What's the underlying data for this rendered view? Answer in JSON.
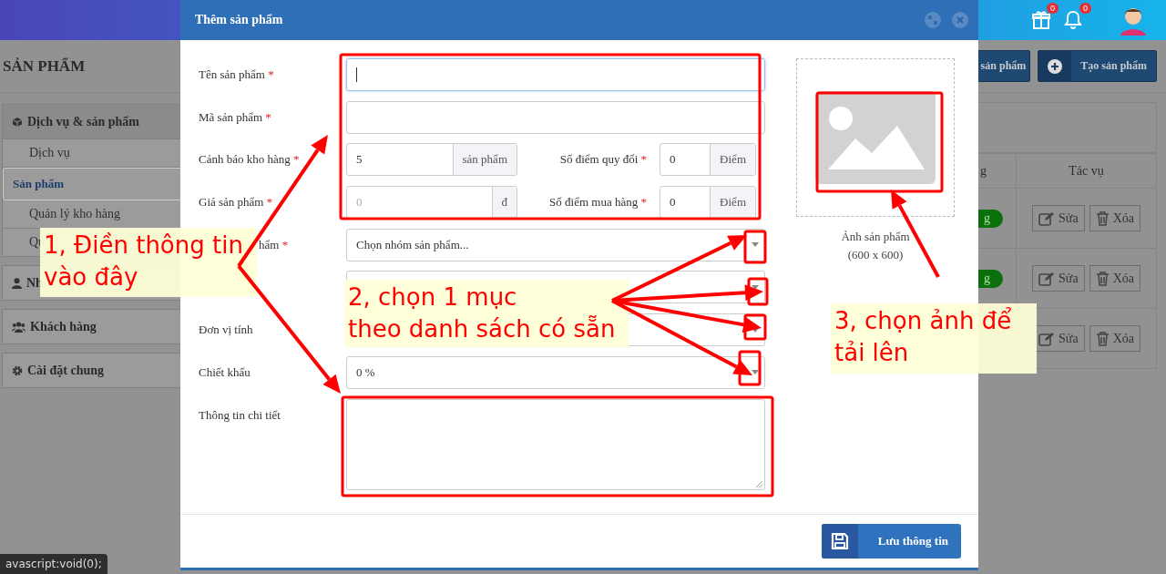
{
  "header": {
    "badges": [
      {
        "count": "0"
      },
      {
        "count": "0"
      }
    ]
  },
  "page_title": "SẢN PHẨM",
  "toolbar_buttons": [
    {
      "kind": "list",
      "label": "sản phẩm"
    },
    {
      "kind": "create",
      "label": "Tạo sản phẩm"
    }
  ],
  "sidebar": {
    "groups": [
      {
        "kind": "box",
        "label": "Dịch vụ & sản phẩm",
        "children": [
          {
            "label": "Dịch vụ",
            "selected": false
          },
          {
            "label": "Sản phẩm",
            "selected": true
          },
          {
            "label": "Quản lý kho hàng",
            "selected": false
          },
          {
            "label": "Qu",
            "selected": false
          }
        ]
      },
      {
        "kind": "user",
        "label": "Nh"
      },
      {
        "kind": "users",
        "label": "Khách hàng"
      },
      {
        "kind": "gear",
        "label": "Cài đặt chung"
      }
    ]
  },
  "table": {
    "columns": [
      "g",
      "Tác vụ"
    ],
    "rows": [
      {
        "status": "g",
        "color": "#0b700b",
        "actions": [
          "Sửa",
          "Xóa"
        ]
      },
      {
        "status": "g",
        "color": "#0b700b",
        "actions": [
          "Sửa",
          "Xóa"
        ]
      },
      {
        "actions": [
          "Sửa",
          "Xóa"
        ]
      }
    ]
  },
  "dialog": {
    "title": "Thêm sản phẩm",
    "fields": [
      {
        "kind": "text",
        "label": "Tên sản phẩm",
        "required_mark": "*",
        "focused": true
      },
      {
        "kind": "text",
        "label": "Mã sản phẩm",
        "required_mark": "*",
        "focused": false
      },
      {
        "kind": "pair",
        "label": "Cảnh báo kho hàng",
        "required_mark": "*",
        "value": "5",
        "addon": "sản phẩm",
        "second": {
          "label": "Số điểm quy đổi",
          "required_mark": "*",
          "value": "0",
          "addon": "Điểm"
        }
      },
      {
        "kind": "pair",
        "label": "Giá sản phẩm",
        "required_mark": "*",
        "placeholder": "0",
        "addon": "đ",
        "second": {
          "label": "Số điểm mua hàng",
          "required_mark": "*",
          "value": "0",
          "addon": "Điểm"
        }
      },
      {
        "kind": "select",
        "label": "hẩm",
        "required_mark": "*",
        "value": "Chọn nhóm sản phẩm..."
      },
      {
        "kind": "select"
      },
      {
        "kind": "select",
        "label": "Đơn vị tính"
      },
      {
        "kind": "select",
        "label": "Chiết khấu",
        "value": "0 %"
      },
      {
        "kind": "textarea",
        "label": "Thông tin chi tiết"
      }
    ],
    "image": {
      "caption": "Ảnh sản phẩm",
      "size": "(600 x 600)"
    },
    "save_button": "Lưu thông tin"
  },
  "notes": [
    {
      "text": "1, Điền thông tin\nvào đây"
    },
    {
      "text": "2, chọn 1 mục\ntheo danh sách có sẵn"
    },
    {
      "text": "3, chọn ảnh để\ntải lên"
    }
  ],
  "status_link": "avascript:void(0);"
}
